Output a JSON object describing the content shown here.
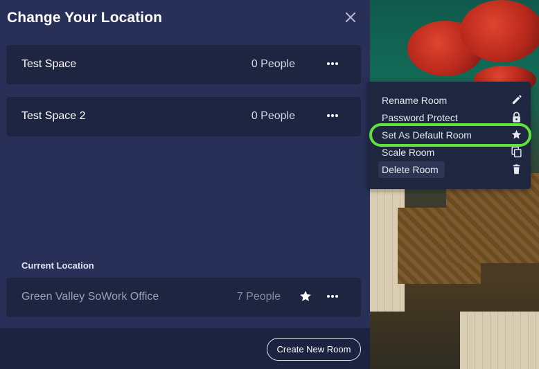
{
  "modal": {
    "title": "Change Your Location",
    "close_icon": "close-icon"
  },
  "rooms": [
    {
      "name": "Test Space",
      "count": "0 People"
    },
    {
      "name": "Test Space 2",
      "count": "0 People"
    }
  ],
  "current": {
    "label": "Current Location",
    "name": "Green Valley SoWork Office",
    "count": "7 People",
    "default_icon": "star-icon"
  },
  "footer": {
    "create_label": "Create New Room"
  },
  "context_menu": {
    "items": [
      {
        "label": "Rename Room",
        "icon": "pencil-icon"
      },
      {
        "label": "Password Protect",
        "icon": "lock-icon"
      },
      {
        "label": "Set As Default Room",
        "icon": "star-icon"
      },
      {
        "label": "Scale Room",
        "icon": "copy-icon"
      },
      {
        "label": "Delete Room",
        "icon": "trash-icon"
      }
    ]
  },
  "colors": {
    "panel": "#283058",
    "card": "#1e2540",
    "highlight": "#5fe33a"
  }
}
